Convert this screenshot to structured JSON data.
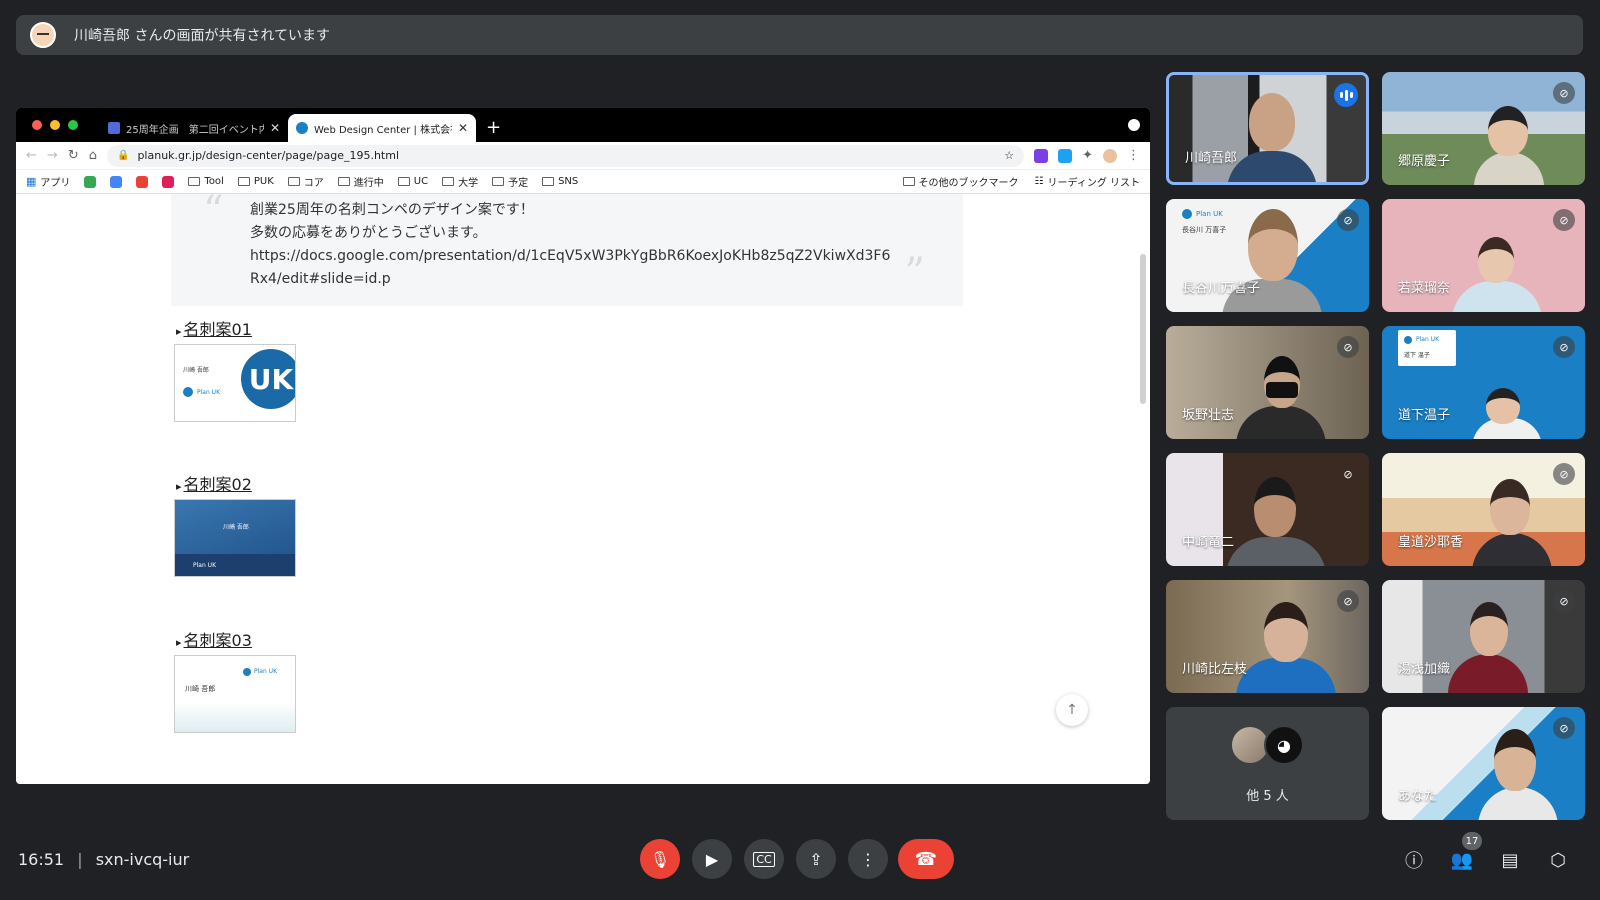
{
  "banner": {
    "text": "川崎吾郎 さんの画面が共有されています"
  },
  "browser": {
    "tabs": [
      {
        "label": "25周年企画　第二回イベント内容"
      },
      {
        "label": "Web Design Center | 株式会社..."
      }
    ],
    "url": "planuk.gr.jp/design-center/page/page_195.html",
    "bookmarks": [
      "アプリ",
      "Tool",
      "PUK",
      "コア",
      "進行中",
      "UC",
      "大学",
      "予定",
      "SNS"
    ],
    "bookmarks_right": [
      "その他のブックマーク",
      "リーディング リスト"
    ]
  },
  "page": {
    "quote_lines": [
      "創業25周年の名刺コンペのデザイン案です！",
      "多数の応募をありがとうございます。",
      "https://docs.google.com/presentation/d/1cEqV5xW3PkYgBbR6KoexJoKHb8z5qZ2VkiwXd3F6",
      "Rx4/edit#slide=id.p"
    ],
    "sections": [
      "名刺案01",
      "名刺案02",
      "名刺案03"
    ],
    "card1": {
      "name": "川崎 吾郎",
      "logo": "Plan UK"
    },
    "card2": {
      "name": "川崎 吾郎",
      "logo": "Plan UK"
    },
    "card3": {
      "name": "川崎 吾郎",
      "logo": "Plan UK"
    }
  },
  "participants": [
    {
      "name": "川崎吾郎",
      "speaking": true
    },
    {
      "name": "郷原慶子"
    },
    {
      "name": "長谷川万喜子"
    },
    {
      "name": "若菜瑠奈"
    },
    {
      "name": "坂野壮志"
    },
    {
      "name": "道下温子"
    },
    {
      "name": "中崎竜二"
    },
    {
      "name": "皇道沙耶香"
    },
    {
      "name": "川崎比左枝"
    },
    {
      "name": "湯浅加織"
    },
    {
      "name": "他 5 人"
    },
    {
      "name": "あなた"
    }
  ],
  "tile_labels": {
    "hasegawa_card": "長谷川 万喜子",
    "michishita_card": "道下 温子",
    "plan_uk": "Plan UK"
  },
  "meeting": {
    "time": "16:51",
    "code": "sxn-ivcq-iur",
    "participant_count": "17"
  },
  "colors": {
    "background": "#202124",
    "tile_blue": "#1a7fc4",
    "hangup": "#ea4335",
    "speaking_border": "#8ab4f8"
  }
}
